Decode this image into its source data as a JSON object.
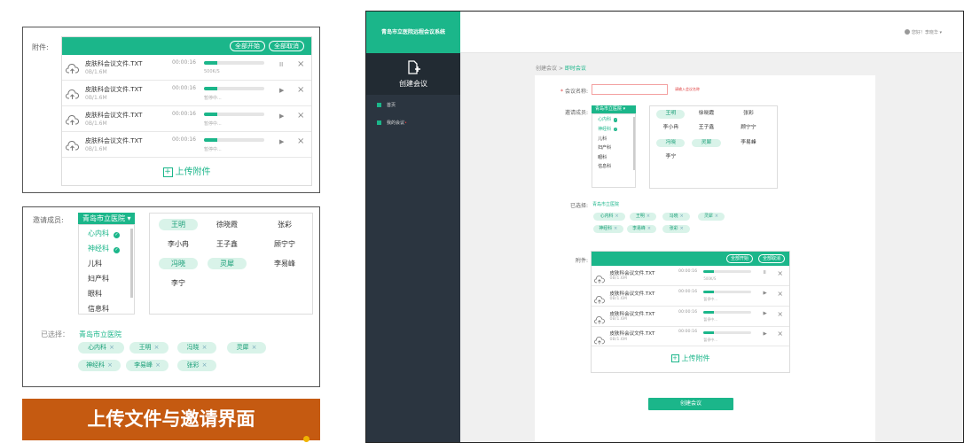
{
  "upload": {
    "label": "附件:",
    "start_all": "全部开始",
    "cancel_all": "全部取消",
    "files": [
      {
        "name": "皮肤科会议文件.TXT",
        "size": "0B/1.6M",
        "time": "00:00:16",
        "progress": 0.22,
        "status": "500K/S",
        "control": "pause"
      },
      {
        "name": "皮肤科会议文件.TXT",
        "size": "0B/1.6M",
        "time": "00:00:16",
        "progress": 0.22,
        "status": "暂停中...",
        "control": "play"
      },
      {
        "name": "皮肤科会议文件.TXT",
        "size": "0B/1.6M",
        "time": "00:00:16",
        "progress": 0.22,
        "status": "暂停中...",
        "control": "play"
      },
      {
        "name": "皮肤科会议文件.TXT",
        "size": "0B/1.6M",
        "time": "00:00:16",
        "progress": 0.22,
        "status": "暂停中...",
        "control": "play"
      }
    ],
    "upload_label": "上传附件",
    "pause_glyph": "II",
    "play_glyph": "▶",
    "close_glyph": "×",
    "plus_glyph": "+"
  },
  "invite": {
    "label": "邀请成员:",
    "hospital": "青岛市立医院",
    "departments": [
      {
        "name": "心内科",
        "checked": true
      },
      {
        "name": "神经科",
        "checked": true
      },
      {
        "name": "儿科",
        "checked": false
      },
      {
        "name": "妇产科",
        "checked": false
      },
      {
        "name": "眼科",
        "checked": false
      },
      {
        "name": "信息科",
        "checked": false
      }
    ],
    "members": [
      {
        "name": "王明",
        "selected": true
      },
      {
        "name": "徐晓霞",
        "selected": false
      },
      {
        "name": "张彩",
        "selected": false
      },
      {
        "name": "李小冉",
        "selected": false
      },
      {
        "name": "王子鑫",
        "selected": false
      },
      {
        "name": "顾宁宁",
        "selected": false
      },
      {
        "name": "冯晓",
        "selected": true
      },
      {
        "name": "灵犀",
        "selected": true
      },
      {
        "name": "李易峰",
        "selected": false
      },
      {
        "name": "李宁",
        "selected": false
      }
    ],
    "selected_label": "已选择：",
    "selected_hospital": "青岛市立医院",
    "selected_tags": [
      "心内科",
      "王明",
      "冯晓",
      "灵犀",
      "神经科",
      "李易峰",
      "张彩"
    ],
    "check_glyph": "✓",
    "dropdown_glyph": "▾",
    "remove_glyph": "×"
  },
  "banner": {
    "title": "上传文件与邀请界面"
  },
  "app": {
    "brand": "青岛市立医院远程会议系统",
    "create_meeting": "创建会议",
    "nav": [
      {
        "label": "首页"
      },
      {
        "label": "我的会议"
      }
    ],
    "user": "您好！李晓华",
    "breadcrumb_root": "创建会议",
    "breadcrumb_sep": ">",
    "breadcrumb_current": "即时会议",
    "form": {
      "name_label": "会议名称:",
      "name_placeholder": "",
      "name_hint": "请输入会议名称",
      "invite_label": "邀请成员:",
      "selected_label": "已选择:",
      "attach_label": "附件:",
      "submit": "创建会议"
    }
  },
  "colors": {
    "accent": "#1bb68a",
    "sidebar": "#2b3540",
    "banner": "#c55a11"
  }
}
